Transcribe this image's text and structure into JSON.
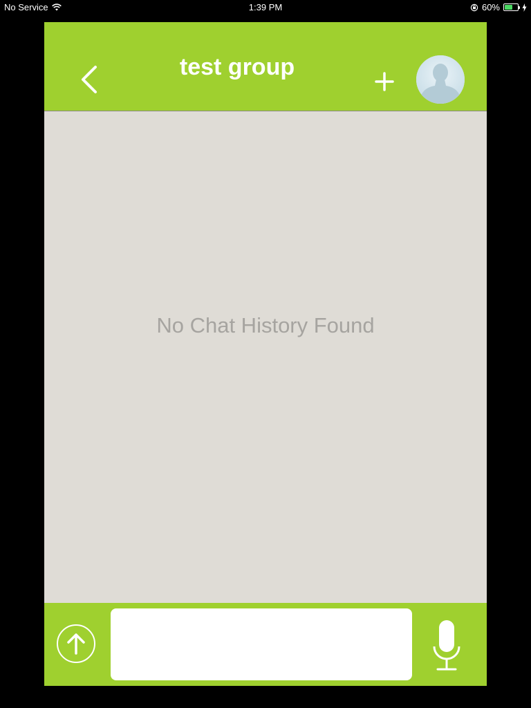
{
  "status_bar": {
    "carrier": "No Service",
    "time": "1:39 PM",
    "battery_percent": "60%",
    "battery_level": 0.6,
    "icons": [
      "wifi-icon",
      "orientation-lock-icon",
      "battery-icon",
      "charging-icon"
    ]
  },
  "header": {
    "title": "test group",
    "back_icon": "chevron-left-icon",
    "add_icon": "plus-icon",
    "avatar_icon": "person-silhouette-icon"
  },
  "chat": {
    "empty_message": "No Chat History Found"
  },
  "composer": {
    "upload_icon": "arrow-up-circle-icon",
    "message_value": "",
    "message_placeholder": "",
    "mic_icon": "microphone-icon"
  },
  "colors": {
    "brand_green": "#9fd02f",
    "chat_background": "#dfdcd6",
    "empty_text": "#a6a4a0"
  }
}
